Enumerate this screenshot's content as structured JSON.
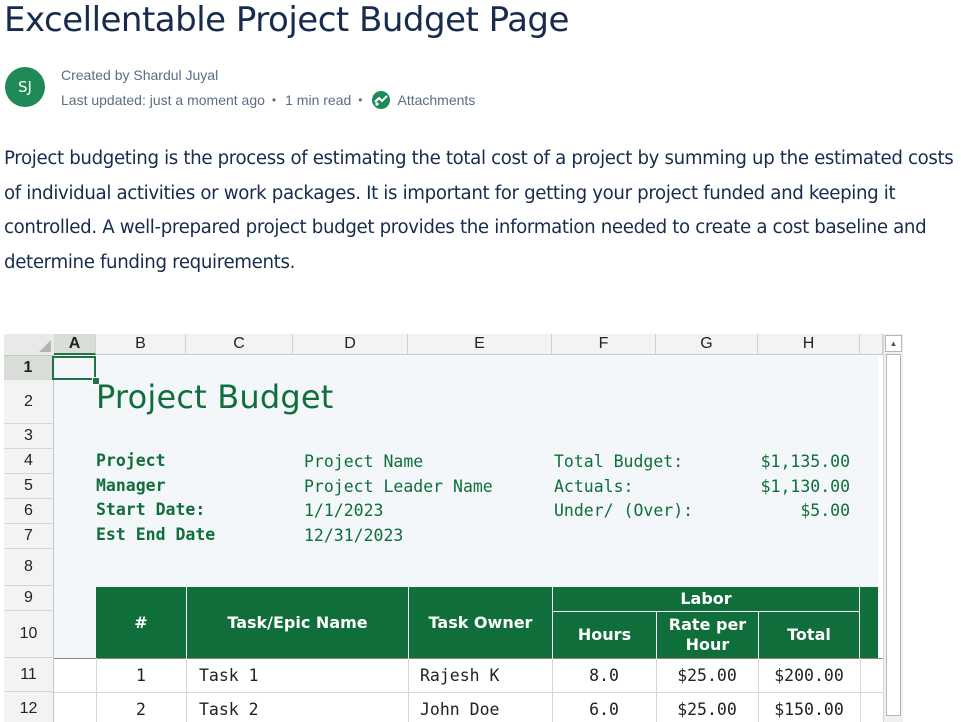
{
  "page": {
    "title": "Excellentable Project Budget Page",
    "avatar_initials": "SJ",
    "created_by": "Created by Shardul Juyal",
    "last_updated": "Last updated: just a moment ago",
    "read_time": "1 min read",
    "attachments_label": "Attachments",
    "intro": "Project budgeting is the process of estimating the total cost of a project by summing up the estimated costs of individual activities or work packages. It is important for getting your project funded and keeping it controlled. A well-prepared project budget provides the information needed to create a cost baseline and determine funding requirements."
  },
  "sheet": {
    "columns": [
      "A",
      "B",
      "C",
      "D",
      "E",
      "F",
      "G",
      "H"
    ],
    "rows": [
      "1",
      "2",
      "3",
      "4",
      "5",
      "6",
      "7",
      "8",
      "9",
      "10",
      "11",
      "12"
    ],
    "title": "Project Budget",
    "labels": {
      "project": "Project",
      "manager": "Manager",
      "start_date": "Start Date:",
      "end_date": "Est End Date",
      "project_name": "Project Name",
      "leader_name": "Project Leader Name",
      "start_value": "1/1/2023",
      "end_value": "12/31/2023",
      "total_budget": "Total Budget:",
      "actuals": "Actuals:",
      "under_over": "Under/ (Over):",
      "total_budget_value": "$1,135.00",
      "actuals_value": "$1,130.00",
      "under_over_value": "$5.00"
    },
    "table_headers": {
      "num": "#",
      "task": "Task/Epic Name",
      "owner": "Task Owner",
      "labor": "Labor",
      "hours": "Hours",
      "rate": "Rate per Hour",
      "total": "Total"
    },
    "tasks": [
      {
        "num": "1",
        "name": "Task 1",
        "owner": "Rajesh K",
        "hours": "8.0",
        "rate": "$25.00",
        "total": "$200.00"
      },
      {
        "num": "2",
        "name": "Task 2",
        "owner": "John Doe",
        "hours": "6.0",
        "rate": "$25.00",
        "total": "$150.00"
      }
    ]
  },
  "colors": {
    "accent_green": "#0f6e3a",
    "avatar_green": "#1f8a58"
  }
}
